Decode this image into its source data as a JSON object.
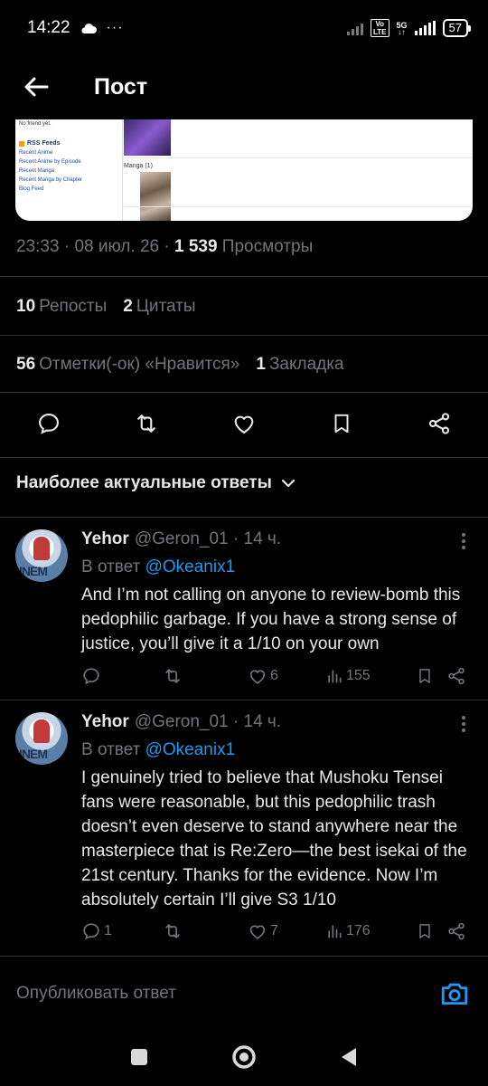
{
  "status_bar": {
    "time": "14:22",
    "network_volte": "Vo\nLTE",
    "network_type": "5G",
    "battery": "57"
  },
  "header": {
    "title": "Пост"
  },
  "media_card": {
    "no_friend": "No friend yet.",
    "rss_title": "RSS Feeds",
    "rss_links": [
      "Recent Anime",
      "Recent Anime by Episode",
      "Recent Manga",
      "Recent Manga by Chapter",
      "Blog Feed"
    ],
    "manga_label": "Manga (1)"
  },
  "post_meta": {
    "time": "23:33",
    "date": "08 июл. 26",
    "views_count": "1 539",
    "views_label": "Просмотры"
  },
  "stats": {
    "reposts_count": "10",
    "reposts_label": "Репосты",
    "quotes_count": "2",
    "quotes_label": "Цитаты",
    "likes_count": "56",
    "likes_label": "Отметки(-ок) «Нравится»",
    "bookmarks_count": "1",
    "bookmarks_label": "Закладка"
  },
  "replies_sort": {
    "label": "Наиболее актуальные ответы"
  },
  "replies": [
    {
      "name": "Yehor",
      "handle": "@Geron_01",
      "age": "· 14 ч.",
      "in_reply_prefix": "В ответ",
      "in_reply_to": "@Okeanix1",
      "avatar_text": "INEM",
      "text": "And I’m not calling on anyone to review-bomb this pedophilic garbage. If you have a strong sense of justice, you’ll give it a 1/10 on your own",
      "reply_count": "",
      "repost_count": "",
      "like_count": "6",
      "view_count": "155"
    },
    {
      "name": "Yehor",
      "handle": "@Geron_01",
      "age": "· 14 ч.",
      "in_reply_prefix": "В ответ",
      "in_reply_to": "@Okeanix1",
      "avatar_text": "INEM",
      "text": "I genuinely tried to believe that Mushoku Tensei fans were reasonable, but this pedophilic trash doesn’t even deserve to stand anywhere near the masterpiece that is Re:Zero—the best isekai of the 21st century. Thanks for the evidence. Now I’m absolutely certain I’ll give S3 1/10",
      "reply_count": "1",
      "repost_count": "",
      "like_count": "7",
      "view_count": "176"
    }
  ],
  "compose": {
    "placeholder": "Опубликовать ответ"
  },
  "colors": {
    "background": "#000000",
    "text": "#e7e9ea",
    "muted": "#71767b",
    "accent": "#1d9bf0",
    "divider": "#2f3336"
  },
  "icons": [
    "back-arrow-icon",
    "reply-icon",
    "repost-icon",
    "like-icon",
    "bookmark-icon",
    "share-icon",
    "views-icon",
    "chevron-down-icon",
    "more-icon",
    "camera-icon"
  ]
}
